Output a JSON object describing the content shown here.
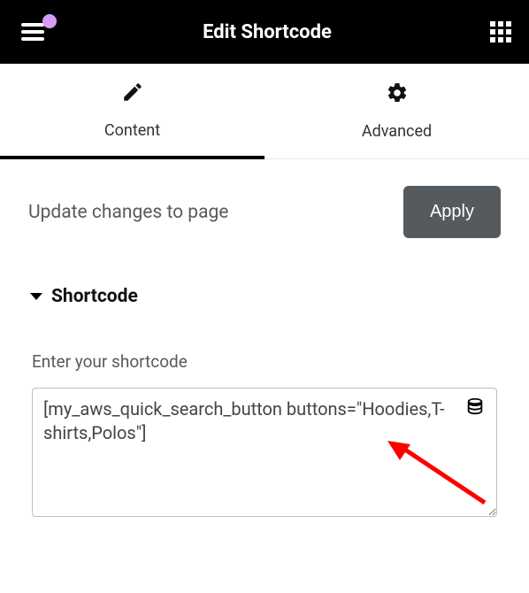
{
  "header": {
    "title": "Edit Shortcode"
  },
  "tabs": {
    "content": {
      "label": "Content"
    },
    "advanced": {
      "label": "Advanced"
    }
  },
  "update": {
    "text": "Update changes to page",
    "apply_label": "Apply"
  },
  "section": {
    "title": "Shortcode"
  },
  "field": {
    "label": "Enter your shortcode",
    "value": "[my_aws_quick_search_button buttons=\"Hoodies,T-shirts,Polos\"]"
  }
}
